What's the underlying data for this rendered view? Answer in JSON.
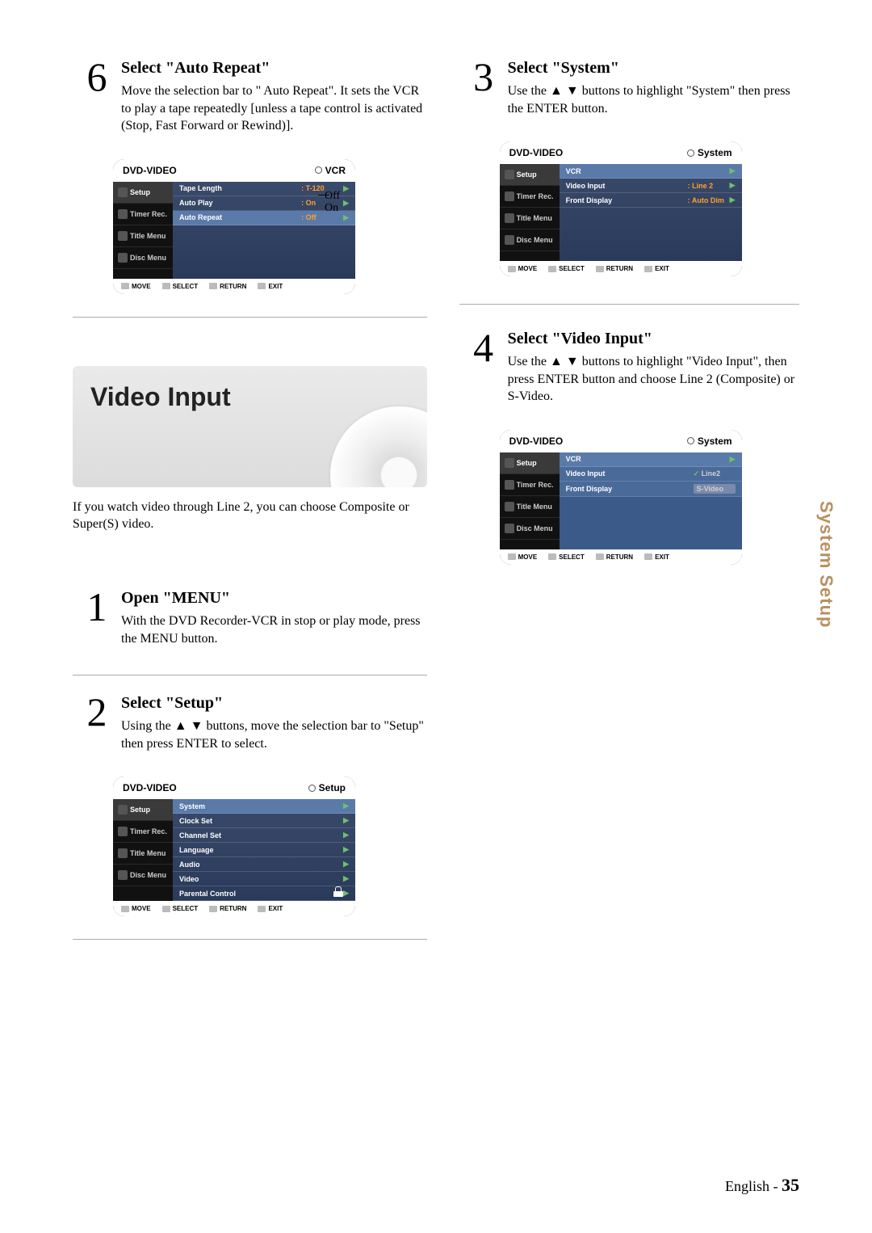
{
  "sideTab": "System Setup",
  "pageFooter": {
    "lang": "English - ",
    "num": "35"
  },
  "steps": {
    "s6": {
      "num": "6",
      "title": "Select \"Auto Repeat\"",
      "desc": "Move the selection bar to \" Auto Repeat\". It sets the VCR to play a tape repeatedly [unless a tape control is activated (Stop, Fast Forward or Rewind)]."
    },
    "s1": {
      "num": "1",
      "title": "Open \"MENU\"",
      "desc": "With the DVD Recorder-VCR in stop or play mode, press the MENU button."
    },
    "s2": {
      "num": "2",
      "title": "Select \"Setup\"",
      "desc": "Using the ▲ ▼ buttons, move the selection bar to \"Setup\" then press ENTER to select."
    },
    "s3": {
      "num": "3",
      "title": "Select \"System\"",
      "desc": "Use the ▲ ▼ buttons to highlight \"System\" then press the ENTER button."
    },
    "s4": {
      "num": "4",
      "title": "Select \"Video Input\"",
      "desc": "Use the ▲ ▼ buttons to highlight \"Video Input\", then press ENTER button and choose Line 2 (Composite) or S-Video."
    }
  },
  "videoInputBox": {
    "title": "Video Input",
    "caption": "If you watch video through Line 2, you can choose Composite or Super(S) video."
  },
  "annot": {
    "off": "Off",
    "on": "On"
  },
  "osdCommon": {
    "header": "DVD-VIDEO",
    "sideItems": {
      "setup": "Setup",
      "timer": "Timer Rec.",
      "title": "Title Menu",
      "disc": "Disc Menu"
    },
    "footer": {
      "move": "MOVE",
      "select": "SELECT",
      "return": "RETURN",
      "exit": "EXIT"
    }
  },
  "osd6": {
    "headerRight": "VCR",
    "rows": {
      "r1": {
        "lbl": "Tape Length",
        "val": ": T-120"
      },
      "r2": {
        "lbl": "Auto Play",
        "val": ": On"
      },
      "r3": {
        "lbl": "Auto Repeat",
        "val": ": Off"
      }
    }
  },
  "osd3": {
    "headerRight": "System",
    "topLabel": "VCR",
    "rows": {
      "r1": {
        "lbl": "Video Input",
        "val": ": Line 2"
      },
      "r2": {
        "lbl": "Front Display",
        "val": ": Auto Dim"
      }
    }
  },
  "osd4": {
    "headerRight": "System",
    "topLabel": "VCR",
    "rows": {
      "r1": {
        "lbl": "Video Input",
        "opt1": "Line2",
        "opt2": "S-Video"
      },
      "r2": {
        "lbl": "Front Display"
      }
    }
  },
  "osd2": {
    "headerRight": "Setup",
    "rows": {
      "r1": "System",
      "r2": "Clock Set",
      "r3": "Channel Set",
      "r4": "Language",
      "r5": "Audio",
      "r6": "Video",
      "r7": "Parental Control"
    }
  }
}
